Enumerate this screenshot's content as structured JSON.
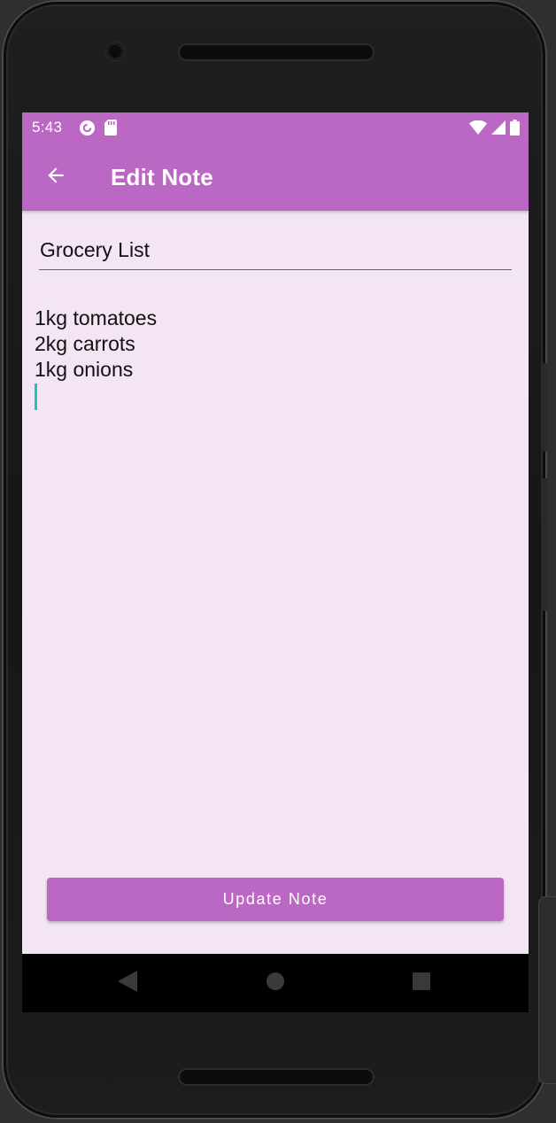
{
  "status_bar": {
    "time": "5:43",
    "left_icons": [
      "pocket-casts-icon",
      "sd-card-icon"
    ],
    "right_icons": [
      "wifi-icon",
      "cell-signal-icon",
      "battery-icon"
    ]
  },
  "app_bar": {
    "back_icon": "arrow-back-icon",
    "title": "Edit Note"
  },
  "note": {
    "title_value": "Grocery List",
    "body_lines": [
      "1kg tomatoes",
      "2kg carrots",
      "1kg onions"
    ]
  },
  "update_button": {
    "label": "Update Note"
  },
  "nav_bar": {
    "icons": [
      "nav-back-icon",
      "nav-home-icon",
      "nav-recents-icon"
    ]
  },
  "colors": {
    "primary": "#bb68c5",
    "background": "#f3e5f4",
    "cursor": "#1ac7b0",
    "on_primary": "#ffffff"
  }
}
